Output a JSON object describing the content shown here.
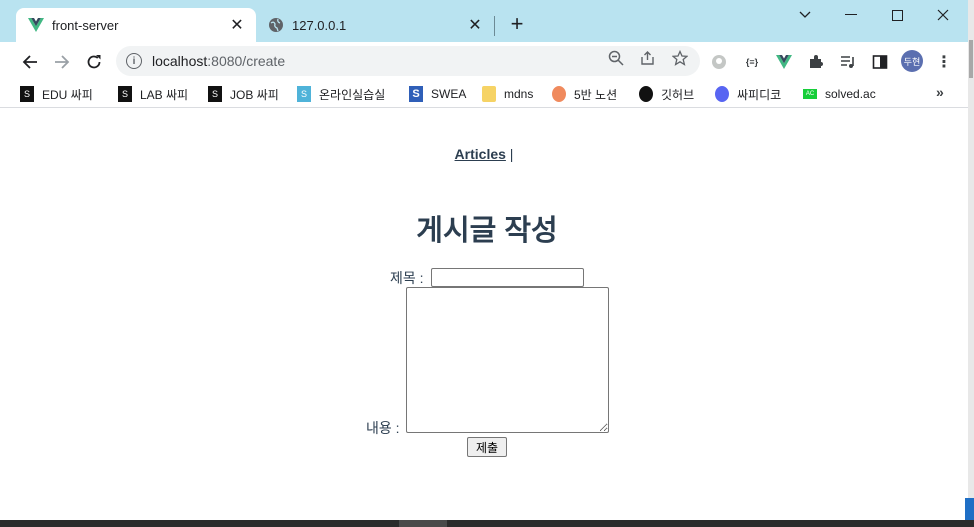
{
  "browser": {
    "tabs": [
      {
        "title": "front-server",
        "icon": "vue-icon",
        "active": true
      },
      {
        "title": "127.0.0.1",
        "icon": "globe-icon",
        "active": false
      }
    ],
    "new_tab": "+",
    "window_controls": {
      "minimize": "─",
      "maximize": "☐",
      "close": "✕",
      "tab_search": "⌄"
    },
    "address": {
      "host": "localhost",
      "path": ":8080/create"
    },
    "profile_label": "두현",
    "bookmarks": [
      {
        "label": "EDU 싸피",
        "icon": "ssafy-icon",
        "color": "#111111"
      },
      {
        "label": "LAB 싸피",
        "icon": "ssafy-icon",
        "color": "#111111"
      },
      {
        "label": "JOB 싸피",
        "icon": "ssafy-icon",
        "color": "#111111"
      },
      {
        "label": "온라인실습실",
        "icon": "ssafy-icon",
        "color": "#4fb3d9"
      },
      {
        "label": "SWEA",
        "icon": "swea-icon",
        "color": "#2f5fb8"
      },
      {
        "label": "mdns",
        "icon": "folder-icon",
        "color": "#f6d365"
      },
      {
        "label": "5반 노션",
        "icon": "peach-icon",
        "color": "#f08a5d"
      },
      {
        "label": "깃허브",
        "icon": "github-icon",
        "color": "#111111"
      },
      {
        "label": "싸피디코",
        "icon": "discord-icon",
        "color": "#5865f2"
      },
      {
        "label": "solved.ac",
        "icon": "solvedac-icon",
        "color": "#17ce3a"
      }
    ],
    "bookmarks_more": "»"
  },
  "page": {
    "nav": {
      "articles_link": "Articles",
      "separator": "|"
    },
    "heading": "게시글 작성",
    "form": {
      "title_label": "제목 :",
      "title_value": "",
      "content_label": "내용 :",
      "content_value": "",
      "submit_label": "제출"
    }
  },
  "colors": {
    "text": "#2c3e50",
    "titlebar": "#b9e3f0",
    "vue_green": "#41b883"
  }
}
